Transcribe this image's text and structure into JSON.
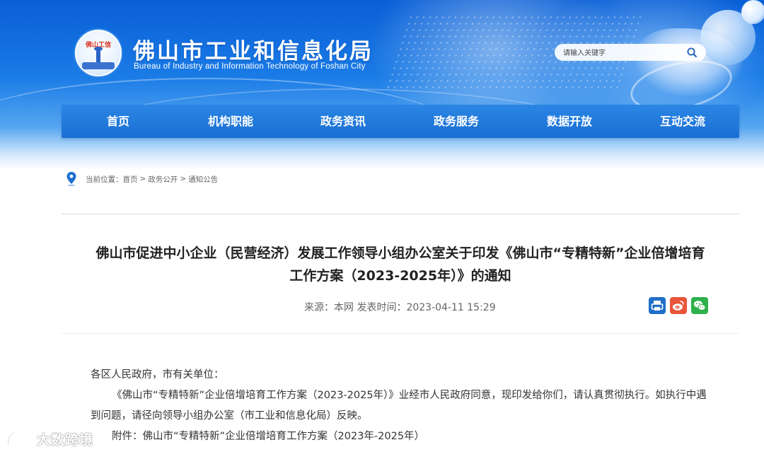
{
  "header": {
    "title": "佛山市工业和信息化局",
    "subtitle": "Bureau of Industry and Information Technology of Foshan City",
    "logo_text": "佛山工信"
  },
  "search": {
    "placeholder": "请输入关键字"
  },
  "nav": {
    "items": [
      {
        "label": "首页"
      },
      {
        "label": "机构职能"
      },
      {
        "label": "政务资讯"
      },
      {
        "label": "政务服务"
      },
      {
        "label": "数据开放"
      },
      {
        "label": "互动交流"
      }
    ]
  },
  "breadcrumb": {
    "prefix": "当前位置：",
    "items": [
      "首页",
      "政务公开",
      "通知公告"
    ],
    "separator": ">"
  },
  "article": {
    "title_line1": "佛山市促进中小企业（民营经济）发展工作领导小组办公室关于印发《佛山市“专精特新”企业倍增培育",
    "title_line2": "工作方案（2023-2025年）》的通知",
    "meta": "来源：本网 发表时间：2023-04-11 15:29",
    "salutation": "各区人民政府，市有关单位：",
    "paragraph1": "《佛山市“专精特新”企业倍增培育工作方案（2023-2025年）》业经市人民政府同意，现印发给你们，请认真贯彻执行。如执行中遇到问题，请径向领导小组办公室（市工业和信息化局）反映。",
    "attachment": "附件：佛山市“专精特新”企业倍增培育工作方案（2023年-2025年）"
  },
  "share": {
    "print_icon": "print-icon",
    "weibo_icon": "weibo-icon",
    "wechat_icon": "wechat-icon"
  },
  "watermark": {
    "text": "大数跨境"
  },
  "colors": {
    "nav_bg": "#1b6fd3",
    "banner_top": "#0a5fd6",
    "print": "#1f6fc9",
    "weibo": "#e8553a",
    "wechat": "#2fb14c"
  }
}
